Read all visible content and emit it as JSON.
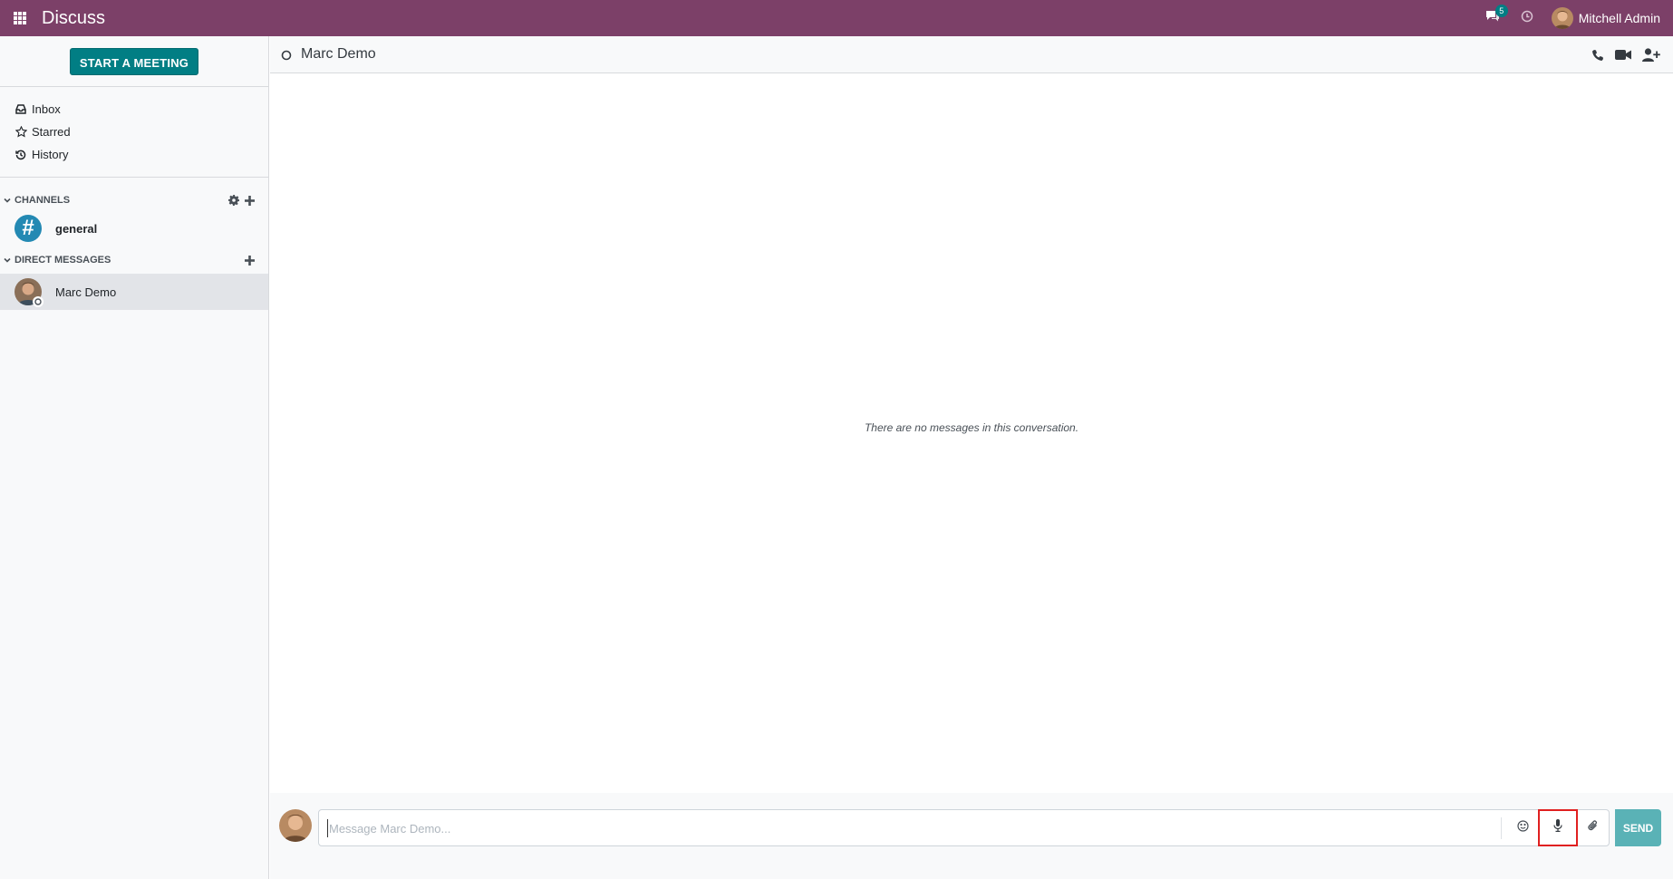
{
  "navbar": {
    "app_title": "Discuss",
    "chat_badge": "5",
    "user_name": "Mitchell Admin"
  },
  "sidebar": {
    "start_meeting_label": "START A MEETING",
    "mailboxes": [
      {
        "label": "Inbox",
        "icon": "inbox-icon"
      },
      {
        "label": "Starred",
        "icon": "star-icon"
      },
      {
        "label": "History",
        "icon": "history-icon"
      }
    ],
    "channels_header": "CHANNELS",
    "channels": [
      {
        "label": "general"
      }
    ],
    "dm_header": "DIRECT MESSAGES",
    "direct_messages": [
      {
        "label": "Marc Demo"
      }
    ]
  },
  "thread": {
    "title": "Marc Demo",
    "empty_text": "There are no messages in this conversation."
  },
  "composer": {
    "placeholder": "Message Marc Demo...",
    "send_label": "SEND"
  },
  "colors": {
    "navbar": "#7c4068",
    "primary": "#017e84",
    "channel_avatar": "#2389b3",
    "send_button": "#5ab2b6",
    "highlight": "#e02020"
  }
}
